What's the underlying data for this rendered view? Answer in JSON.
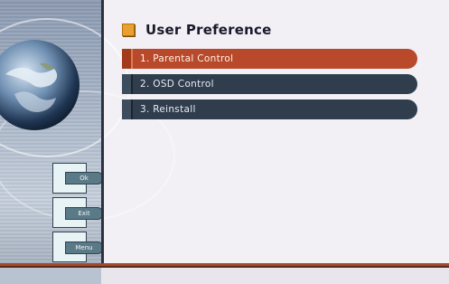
{
  "screen": {
    "title": "User Preference",
    "accent_color": "#b8492a",
    "menu_color": "#2f3d4d"
  },
  "menu": {
    "items": [
      {
        "label": "1. Parental Control",
        "selected": true
      },
      {
        "label": "2. OSD Control",
        "selected": false
      },
      {
        "label": "3. Reinstall",
        "selected": false
      }
    ]
  },
  "keys": {
    "ok_label": "Ok",
    "exit_label": "Exit",
    "menu_label": "Menu"
  },
  "decor": {
    "globe_icon": "earth-globe-icon"
  }
}
